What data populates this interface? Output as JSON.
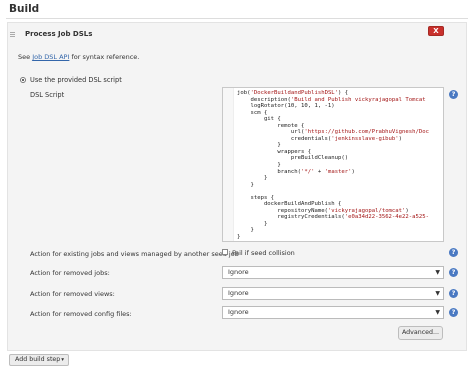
{
  "header": {
    "title": "Build"
  },
  "step": {
    "title": "Process Job DSLs",
    "delete_label": "X",
    "see_prefix": "See ",
    "see_link": "Job DSL API",
    "see_suffix": " for syntax reference.",
    "radio_label": "Use the provided DSL script",
    "dsl_label": "DSL Script",
    "code_lines": [
      "job('DockerBuildandPublishDSL') {",
      "    description('Build and Publish vickyrajagopal Tomcat ",
      "    logRotator(10, 10, 1, -1)",
      "    scm {",
      "        git {",
      "            remote {",
      "                url('https://github.com/PrabhuVignesh/Doc",
      "                credentials('jenkinsslave-gibub')",
      "            }",
      "            wrappers {",
      "                preBuildCleanup()",
      "            }",
      "            branch('*/' + 'master')",
      "        }",
      "    }",
      "",
      "    steps {",
      "        dockerBuildAndPublish {",
      "            repositoryName('vickyrajagopal/tomcat')",
      "            registryCredentials('e0a34d22-3562-4e22-a525-",
      "        }",
      "    }",
      "}"
    ],
    "existing_jobs_label": "Action for existing jobs and views managed by another seed job",
    "fail_collision_label": "Fail if seed collision",
    "removed_jobs_label": "Action for removed jobs:",
    "removed_jobs_value": "Ignore",
    "removed_views_label": "Action for removed views:",
    "removed_views_value": "Ignore",
    "removed_config_label": "Action for removed config files:",
    "removed_config_value": "Ignore",
    "advanced_label": "Advanced...",
    "help_icon_label": "?"
  },
  "footer": {
    "add_build_step_label": "Add build step",
    "caret": "▾"
  },
  "colors": {
    "delete": "#c9302c",
    "help": "#4a79c2",
    "link": "#3366aa",
    "string": "#a31515"
  }
}
